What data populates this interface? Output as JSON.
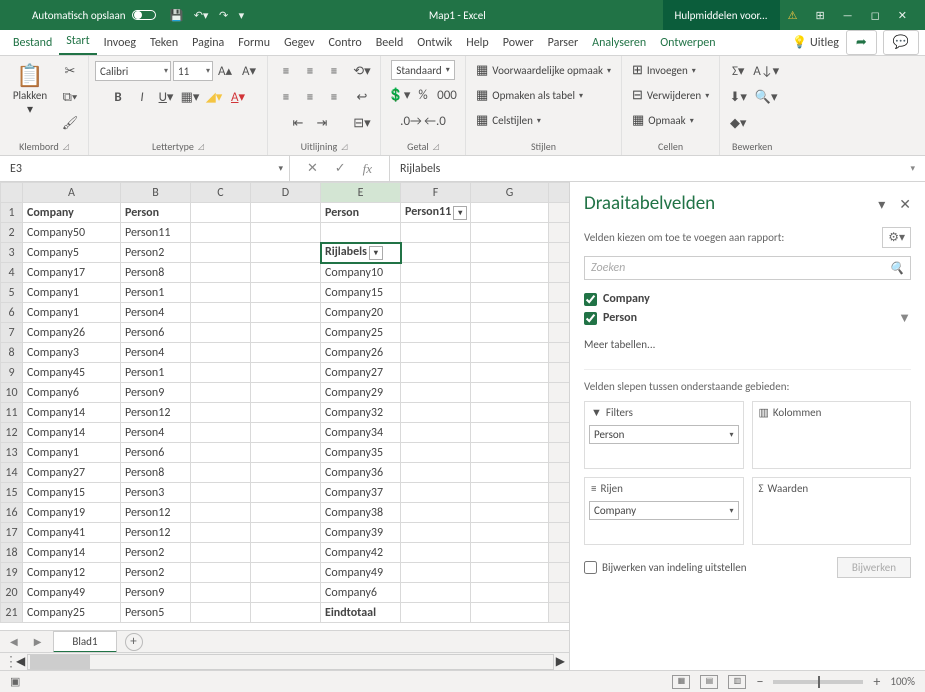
{
  "titlebar": {
    "autosave": "Automatisch opslaan",
    "title": "Map1  -  Excel",
    "tools": "Hulpmiddelen voor..."
  },
  "tabs": {
    "file": "Bestand",
    "home": "Start",
    "insert": "Invoeg",
    "draw": "Teken",
    "pagelayout": "Pagina",
    "formulas": "Formu",
    "data": "Gegev",
    "review": "Contro",
    "view": "Beeld",
    "developer": "Ontwik",
    "help": "Help",
    "power": "Power",
    "parser": "Parser",
    "analyze": "Analyseren",
    "design": "Ontwerpen",
    "tell": "Uitleg"
  },
  "ribbon": {
    "clipboard": {
      "paste": "Plakken",
      "label": "Klembord"
    },
    "font": {
      "name": "Calibri",
      "size": "11",
      "label": "Lettertype"
    },
    "align": {
      "label": "Uitlijning"
    },
    "number": {
      "format": "Standaard",
      "label": "Getal"
    },
    "styles": {
      "cond": "Voorwaardelijke opmaak",
      "table": "Opmaken als tabel",
      "cell": "Celstijlen",
      "label": "Stijlen"
    },
    "cells": {
      "insert": "Invoegen",
      "delete": "Verwijderen",
      "format": "Opmaak",
      "label": "Cellen"
    },
    "editing": {
      "label": "Bewerken"
    }
  },
  "namebox": "E3",
  "formula": "Rijlabels",
  "grid": {
    "cols": [
      "A",
      "B",
      "C",
      "D",
      "E",
      "F",
      "G"
    ],
    "rows": [
      {
        "n": 1,
        "A": "Company",
        "B": "Person",
        "E": "Person",
        "F": "Person11",
        "bold": true,
        "filterF": true
      },
      {
        "n": 2,
        "A": "Company50",
        "B": "Person11"
      },
      {
        "n": 3,
        "A": "Company5",
        "B": "Person2",
        "E": "Rijlabels",
        "boldE": true,
        "filterE": true,
        "selected": true
      },
      {
        "n": 4,
        "A": "Company17",
        "B": "Person8",
        "E": "Company10"
      },
      {
        "n": 5,
        "A": "Company1",
        "B": "Person1",
        "E": "Company15"
      },
      {
        "n": 6,
        "A": "Company1",
        "B": "Person4",
        "E": "Company20"
      },
      {
        "n": 7,
        "A": "Company26",
        "B": "Person6",
        "E": "Company25"
      },
      {
        "n": 8,
        "A": "Company3",
        "B": "Person4",
        "E": "Company26"
      },
      {
        "n": 9,
        "A": "Company45",
        "B": "Person1",
        "E": "Company27"
      },
      {
        "n": 10,
        "A": "Company6",
        "B": "Person9",
        "E": "Company29"
      },
      {
        "n": 11,
        "A": "Company14",
        "B": "Person12",
        "E": "Company32"
      },
      {
        "n": 12,
        "A": "Company14",
        "B": "Person4",
        "E": "Company34"
      },
      {
        "n": 13,
        "A": "Company1",
        "B": "Person6",
        "E": "Company35"
      },
      {
        "n": 14,
        "A": "Company27",
        "B": "Person8",
        "E": "Company36"
      },
      {
        "n": 15,
        "A": "Company15",
        "B": "Person3",
        "E": "Company37"
      },
      {
        "n": 16,
        "A": "Company19",
        "B": "Person12",
        "E": "Company38"
      },
      {
        "n": 17,
        "A": "Company41",
        "B": "Person12",
        "E": "Company39"
      },
      {
        "n": 18,
        "A": "Company14",
        "B": "Person2",
        "E": "Company42"
      },
      {
        "n": 19,
        "A": "Company12",
        "B": "Person2",
        "E": "Company49"
      },
      {
        "n": 20,
        "A": "Company49",
        "B": "Person9",
        "E": "Company6"
      },
      {
        "n": 21,
        "A": "Company25",
        "B": "Person5",
        "E": "Eindtotaal",
        "boldE": true
      }
    ]
  },
  "sheet": "Blad1",
  "pane": {
    "title": "Draaitabelvelden",
    "sub": "Velden kiezen om toe te voegen aan rapport:",
    "search": "Zoeken",
    "fields": [
      {
        "name": "Company",
        "checked": true
      },
      {
        "name": "Person",
        "checked": true
      }
    ],
    "more": "Meer tabellen...",
    "areas_label": "Velden slepen tussen onderstaande gebieden:",
    "filters": "Filters",
    "columns": "Kolommen",
    "rows": "Rijen",
    "values": "Waarden",
    "filter_chip": "Person",
    "row_chip": "Company",
    "defer": "Bijwerken van indeling uitstellen",
    "update": "Bijwerken"
  },
  "zoom": "100%"
}
